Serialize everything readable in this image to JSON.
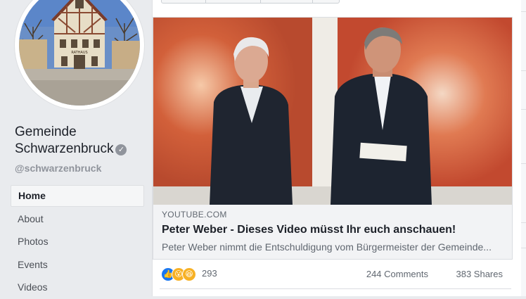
{
  "page": {
    "name": "Gemeinde Schwarzenbruck",
    "handle": "@schwarzenbruck",
    "verified_icon": "check-icon",
    "avatar_sign": "RATHAUS"
  },
  "side_nav": {
    "items": [
      {
        "label": "Home",
        "active": true
      },
      {
        "label": "About"
      },
      {
        "label": "Photos"
      },
      {
        "label": "Events"
      },
      {
        "label": "Videos"
      }
    ]
  },
  "post": {
    "link": {
      "domain": "YOUTUBE.COM",
      "title": "Peter Weber - Dieses Video müsst Ihr euch anschauen!",
      "description": "Peter Weber nimmt die Entschuldigung vom Bürgermeister der Gemeinde..."
    },
    "stats": {
      "reaction_icons": [
        "like-icon",
        "wow-icon",
        "haha-icon"
      ],
      "reaction_count": "293",
      "comments": "244 Comments",
      "shares": "383 Shares"
    }
  },
  "colors": {
    "brand_blue": "#1877f2",
    "text_primary": "#1d2129",
    "text_secondary": "#606770",
    "background": "#e9ebee"
  }
}
